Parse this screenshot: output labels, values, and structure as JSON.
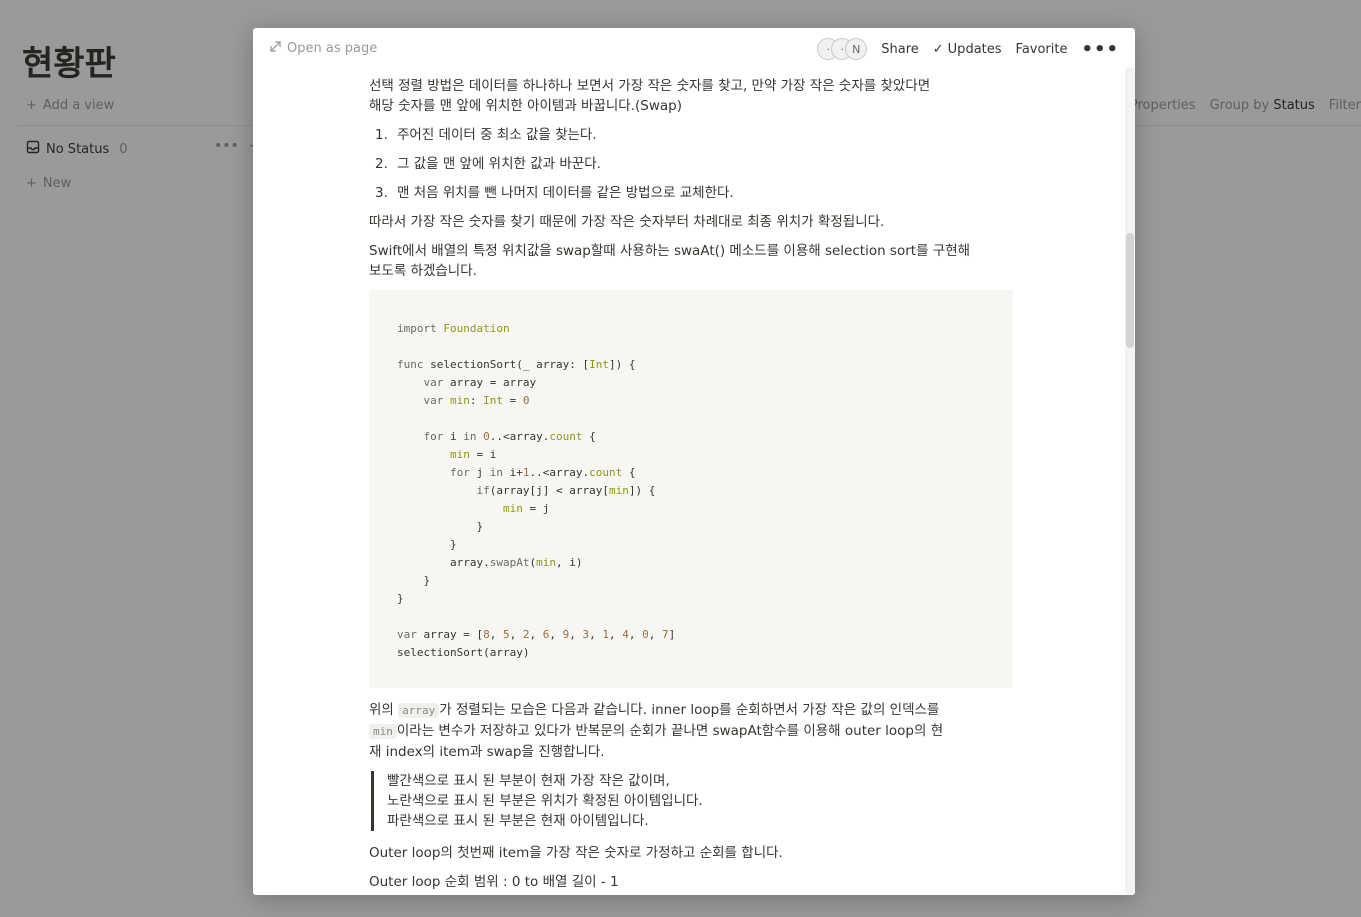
{
  "board": {
    "title": "현황판",
    "add_view": "Add a view",
    "tools": {
      "properties": "Properties",
      "group_by": "Group by",
      "group_by_value": "Status",
      "filter": "Filter"
    },
    "column": {
      "label": "No Status",
      "count": "0",
      "new_label": "New"
    }
  },
  "modal": {
    "open_as_page": "Open as page",
    "avatar_letter": "N",
    "share": "Share",
    "updates": "Updates",
    "favorite": "Favorite",
    "more": "•••"
  },
  "content": {
    "intro_line1": "선택 정렬 방법은 데이터를 하나하나 보면서 가장 작은 숫자를 찾고, 만약 가장 작은 숫자를 찾았다면",
    "intro_line2": "해당 숫자를 맨 앞에 위치한 아이템과 바꿉니다.(Swap)",
    "steps": [
      {
        "num": "1.",
        "text": "주어진 데이터 중 최소 값을 찾는다."
      },
      {
        "num": "2.",
        "text": "그 값을 맨 앞에 위치한 값과 바꾼다."
      },
      {
        "num": "3.",
        "text": "맨 처음 위치를 뺀 나머지 데이터를 같은 방법으로 교체한다."
      }
    ],
    "para_fixed": "따라서 가장 작은 숫자를 찾기 때문에 가장 작은 숫자부터 차례대로 최종 위치가 확정됩니다.",
    "swift_line1": "Swift에서 배열의 특정 위치값을 swap할때 사용하는 swaAt() 메소드를 이용해 selection sort를 구현해",
    "swift_line2": "보도록 하겠습니다.",
    "after_code": {
      "l1_pre": "위의 ",
      "code_array": "array",
      "l1_post": "가 정렬되는 모습은 다음과 같습니다. inner loop를 순회하면서 가장 작은 값의 인덱스를",
      "code_min": "min",
      "l2_post": "이라는 변수가 저장하고 있다가 반복문의 순회가 끝나면 swapAt함수를 이용해 outer loop의 현",
      "l3": "재 index의 item과 swap을 진행합니다."
    },
    "quote": [
      "빨간색으로 표시 된 부분이 현재 가장 작은 값이며,",
      "노란색으로 표시 된 부분은 위치가 확정된 아이템입니다.",
      "파란색으로 표시 된 부분은 현재 아이템입니다."
    ],
    "outer_loop_1": "Outer loop의 첫번째  item을 가장 작은 숫자로 가정하고 순회를 합니다.",
    "outer_loop_2": "Outer loop 순회 범위 : 0 to 배열 길이 - 1"
  }
}
